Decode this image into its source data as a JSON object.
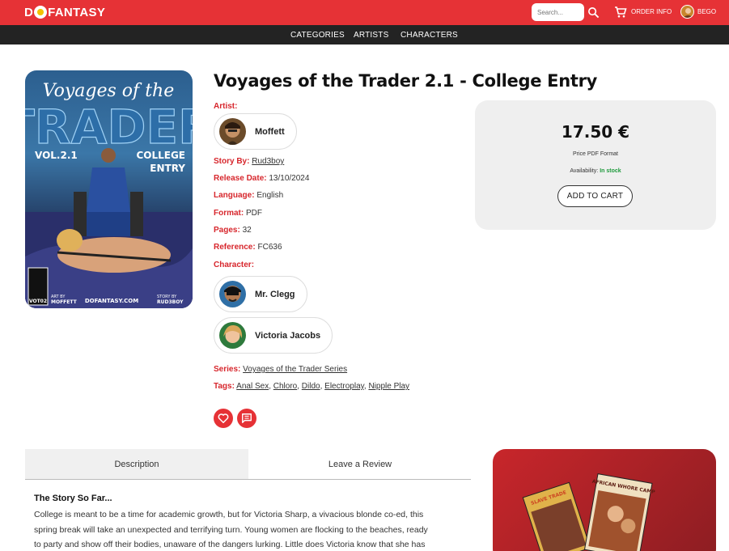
{
  "header": {
    "logo_text_left": "D",
    "logo_text_right": "FANTASY",
    "search_placeholder": "Search...",
    "order_info": "ORDER INFO",
    "user_name": "BEGO"
  },
  "nav": {
    "items": [
      "CATEGORIES",
      "ARTISTS",
      "CHARACTERS"
    ]
  },
  "cover": {
    "line1": "Voyages of the",
    "line2": "TRADER",
    "vol": "VOL.2.1",
    "sub1": "COLLEGE",
    "sub2": "ENTRY",
    "art_by_label": "ART BY",
    "art_by": "MOFFETT",
    "site": "DOFANTASY.COM",
    "story_by_label": "STORY BY",
    "story_by": "RUD3BOY",
    "code": "VOT02"
  },
  "product": {
    "title": "Voyages of the Trader 2.1 - College Entry",
    "artist_label": "Artist:",
    "artist": "Moffett",
    "story_by_label": "Story By:",
    "story_by": "Rud3boy",
    "release_label": "Release Date:",
    "release": "13/10/2024",
    "language_label": "Language:",
    "language": "English",
    "format_label": "Format:",
    "format": "PDF",
    "pages_label": "Pages:",
    "pages": "32",
    "reference_label": "Reference:",
    "reference": "FC636",
    "character_label": "Character:",
    "characters": [
      "Mr. Clegg",
      "Victoria Jacobs"
    ],
    "series_label": "Series:",
    "series": "Voyages of the Trader Series",
    "tags_label": "Tags:",
    "tags": [
      "Anal Sex",
      "Chloro",
      "Dildo",
      "Electroplay",
      "Nipple Play"
    ],
    "tag_sep": ","
  },
  "price_box": {
    "price": "17.50 €",
    "note": "Price PDF Format",
    "availability_label": "Availability:",
    "availability": "In stock",
    "add_to_cart": "ADD TO CART"
  },
  "tabs": {
    "description": "Description",
    "review": "Leave a Review"
  },
  "description": {
    "heading": "The Story So Far...",
    "line1": "College is meant to be a time for academic growth, but for Victoria Sharp, a vivacious blonde co-ed, this",
    "line2": "spring break will take an unexpected and terrifying turn. Young women are flocking to the beaches, ready",
    "line3": "to party and show off their bodies, unaware of the dangers lurking. Little does Victoria know that she has"
  },
  "promo": {
    "comic1": "AFRICAN WHORE CAMP",
    "comic2": "SLAVE TRADE"
  },
  "colors": {
    "brand_red": "#e63236",
    "dark_nav": "#232323",
    "in_stock": "#1e9a3c"
  }
}
